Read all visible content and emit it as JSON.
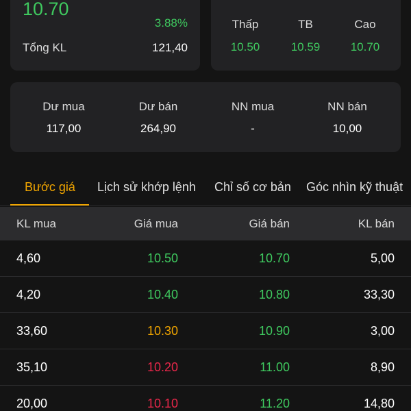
{
  "colors": {
    "up": "#3fc95f",
    "ref": "#f0a500",
    "down": "#e8274a",
    "ceiling": "#d130d6",
    "floor": "#35c3e6",
    "accent": "#f0a500"
  },
  "summary": {
    "price": "10.70",
    "change_pct": "3.88%",
    "volume_label": "Tổng KL",
    "volume_value": "121,40"
  },
  "range": {
    "stats": [
      {
        "label": "Thấp",
        "value": "10.50"
      },
      {
        "label": "TB",
        "value": "10.59"
      },
      {
        "label": "Cao",
        "value": "10.70"
      }
    ]
  },
  "orders": {
    "items": [
      {
        "label": "Dư mua",
        "value": "117,00"
      },
      {
        "label": "Dư bán",
        "value": "264,90"
      },
      {
        "label": "NN mua",
        "value": "-"
      },
      {
        "label": "NN bán",
        "value": "10,00"
      }
    ]
  },
  "tabs": [
    {
      "label": "Bước giá",
      "active": true
    },
    {
      "label": "Lịch sử khớp lệnh",
      "active": false
    },
    {
      "label": "Chỉ số cơ bản",
      "active": false
    },
    {
      "label": "Góc nhìn kỹ thuật",
      "active": false
    }
  ],
  "table": {
    "headers": [
      "KL mua",
      "Giá mua",
      "Giá bán",
      "KL bán"
    ],
    "rows": [
      {
        "bid_vol": "4,60",
        "bid_price": "10.50",
        "bid_color": "up",
        "ask_price": "10.70",
        "ask_vol": "5,00"
      },
      {
        "bid_vol": "4,20",
        "bid_price": "10.40",
        "bid_color": "up",
        "ask_price": "10.80",
        "ask_vol": "33,30"
      },
      {
        "bid_vol": "33,60",
        "bid_price": "10.30",
        "bid_color": "ref",
        "ask_price": "10.90",
        "ask_vol": "3,00"
      },
      {
        "bid_vol": "35,10",
        "bid_price": "10.20",
        "bid_color": "down",
        "ask_price": "11.00",
        "ask_vol": "8,90"
      },
      {
        "bid_vol": "20,00",
        "bid_price": "10.10",
        "bid_color": "down",
        "ask_price": "11.20",
        "ask_vol": "14,80"
      }
    ]
  }
}
